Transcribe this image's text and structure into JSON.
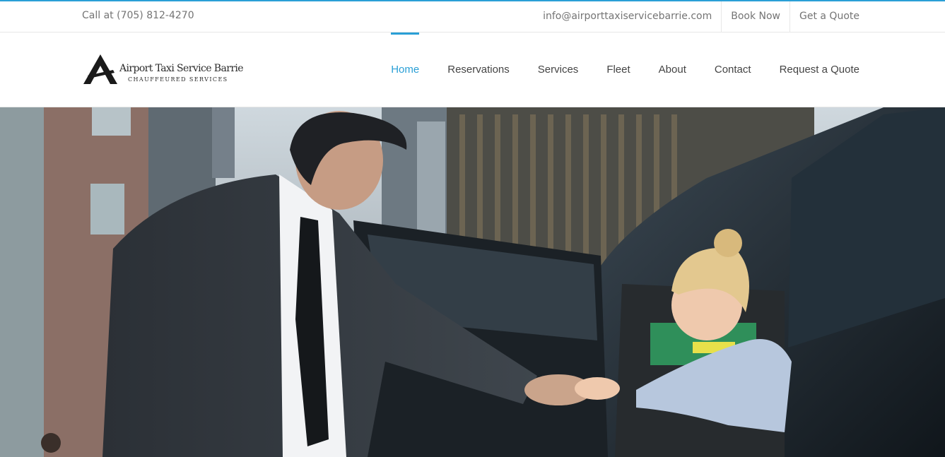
{
  "topbar": {
    "phone": "Call at (705) 812-4270",
    "email": "info@airporttaxiservicebarrie.com",
    "book_now": "Book Now",
    "get_quote": "Get a Quote"
  },
  "brand": {
    "name": "Airport Taxi Service Barrie",
    "tagline": "CHAUFFEURED SERVICES",
    "accent_color": "#2a9fd6"
  },
  "nav": {
    "items": [
      {
        "label": "Home",
        "active": true
      },
      {
        "label": "Reservations"
      },
      {
        "label": "Services"
      },
      {
        "label": "Fleet"
      },
      {
        "label": "About"
      },
      {
        "label": "Contact"
      },
      {
        "label": "Request a Quote"
      }
    ]
  },
  "hero": {
    "image_description_icon": "chauffeur-helping-passenger-photo"
  }
}
